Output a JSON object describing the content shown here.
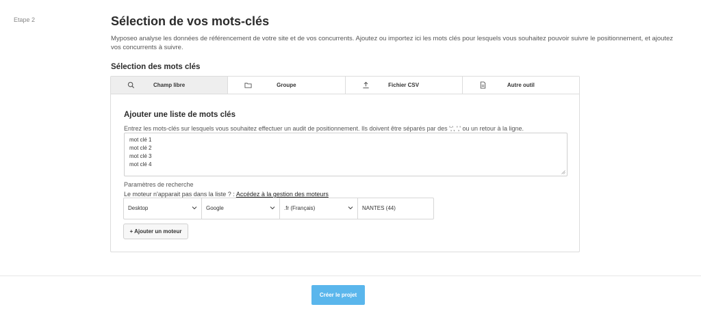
{
  "step": {
    "label": "Etape 2"
  },
  "header": {
    "title": "Sélection de vos mots-clés",
    "intro": "Myposeo analyse les données de référencement de votre site et de vos concurrents. Ajoutez ou importez ici les mots clés pour lesquels vous souhaitez pouvoir suivre le positionnement, et ajoutez vos concurrents à suivre."
  },
  "keywords_section": {
    "title": "Sélection des mots clés",
    "tabs": [
      {
        "label": "Champ libre",
        "icon": "search-icon",
        "active": true
      },
      {
        "label": "Groupe",
        "icon": "folder-icon",
        "active": false
      },
      {
        "label": "Fichier CSV",
        "icon": "upload-icon",
        "active": false
      },
      {
        "label": "Autre outil",
        "icon": "document-icon",
        "active": false
      }
    ],
    "panel": {
      "title": "Ajouter une liste de mots clés",
      "description": "Entrez les mots-clés sur lesquels vous souhaitez effectuer un audit de positionnement. Ils doivent être séparés par des ';', ',' ou un retour à la ligne.",
      "keywords": [
        "mot clé 1",
        "mot clé 2",
        "mot clé 3",
        "mot clé 4"
      ],
      "params_label": "Paramètres de recherche",
      "params_hint": "Le moteur n'apparait pas dans la liste ? : ",
      "params_link": "Accédez à la gestion des moteurs",
      "engine": {
        "device": "Desktop",
        "engine": "Google",
        "language": ".fr (Français)",
        "location": "NANTES (44)"
      },
      "add_engine_label": "+ Ajouter un moteur"
    }
  },
  "footer": {
    "create_label": "Créer le projet"
  },
  "colors": {
    "primary": "#5ab6ec",
    "tab_active_bg": "#eeeeee",
    "border": "#dcdcdc"
  }
}
